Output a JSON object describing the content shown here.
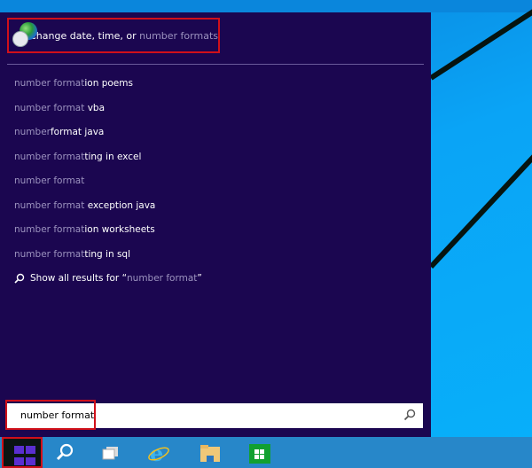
{
  "best_match": {
    "label_plain": "Change date, time, or ",
    "label_dim": "number format",
    "label_end": "s",
    "icon": "date-time-globe-clock-icon"
  },
  "suggestions": [
    {
      "typed": "number format",
      "rest": "ion poems"
    },
    {
      "typed": "number format",
      "rest": " vba"
    },
    {
      "typed": "number",
      "rest": "format java"
    },
    {
      "typed": "number format",
      "rest": "ting in excel"
    },
    {
      "typed": "number format",
      "rest": ""
    },
    {
      "typed": "number format",
      "rest": " exception java"
    },
    {
      "typed": "number format",
      "rest": "ion worksheets"
    },
    {
      "typed": "number format",
      "rest": "ting in sql"
    }
  ],
  "show_all": {
    "prefix": "Show all results for “",
    "query": "number format",
    "suffix": "”"
  },
  "search": {
    "value": "number format"
  },
  "taskbar": {
    "items": [
      "start-windows-icon",
      "search-icon",
      "task-view-icon",
      "internet-explorer-icon",
      "file-explorer-icon",
      "store-icon"
    ]
  },
  "colors": {
    "panel": "#1b0650",
    "highlight_box": "#d0101a",
    "taskbar": "#2787c9",
    "desktop": "#0aa4f6"
  }
}
